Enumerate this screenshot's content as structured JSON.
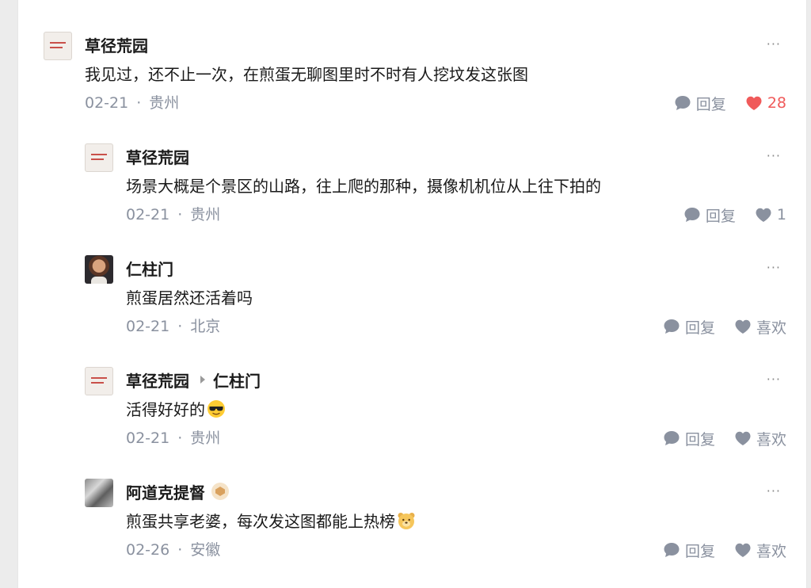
{
  "actions": {
    "reply": "回复",
    "like": "喜欢",
    "more": "···"
  },
  "colors": {
    "liked": "#f05a5a",
    "muted": "#8a919f",
    "text": "#1a1a1a"
  },
  "comments": [
    {
      "author": "草径荒园",
      "reply_to": "",
      "text": "我见过，还不止一次，在煎蛋无聊图里时不时有人挖坟发这张图",
      "emoji": "",
      "date": "02-21",
      "location": "贵州",
      "likes": "28",
      "liked": true,
      "avatar": "paper-avatar",
      "badge": false
    },
    {
      "author": "草径荒园",
      "reply_to": "",
      "text": "场景大概是个景区的山路，往上爬的那种，摄像机机位从上往下拍的",
      "emoji": "",
      "date": "02-21",
      "location": "贵州",
      "likes": "1",
      "liked": false,
      "avatar": "paper-avatar",
      "badge": false
    },
    {
      "author": "仁柱门",
      "reply_to": "",
      "text": "煎蛋居然还活着吗",
      "emoji": "",
      "date": "02-21",
      "location": "北京",
      "likes": "喜欢",
      "liked": false,
      "avatar": "portrait-avatar",
      "badge": false
    },
    {
      "author": "草径荒园",
      "reply_to": "仁柱门",
      "text": "活得好好的",
      "emoji": "sunglasses-emoji",
      "date": "02-21",
      "location": "贵州",
      "likes": "喜欢",
      "liked": false,
      "avatar": "paper-avatar",
      "badge": false
    },
    {
      "author": "阿道克提督",
      "reply_to": "",
      "text": "煎蛋共享老婆，每次发这图都能上热榜",
      "emoji": "bear-emoji",
      "date": "02-26",
      "location": "安徽",
      "likes": "喜欢",
      "liked": false,
      "avatar": "gray-avatar",
      "badge": true
    }
  ]
}
